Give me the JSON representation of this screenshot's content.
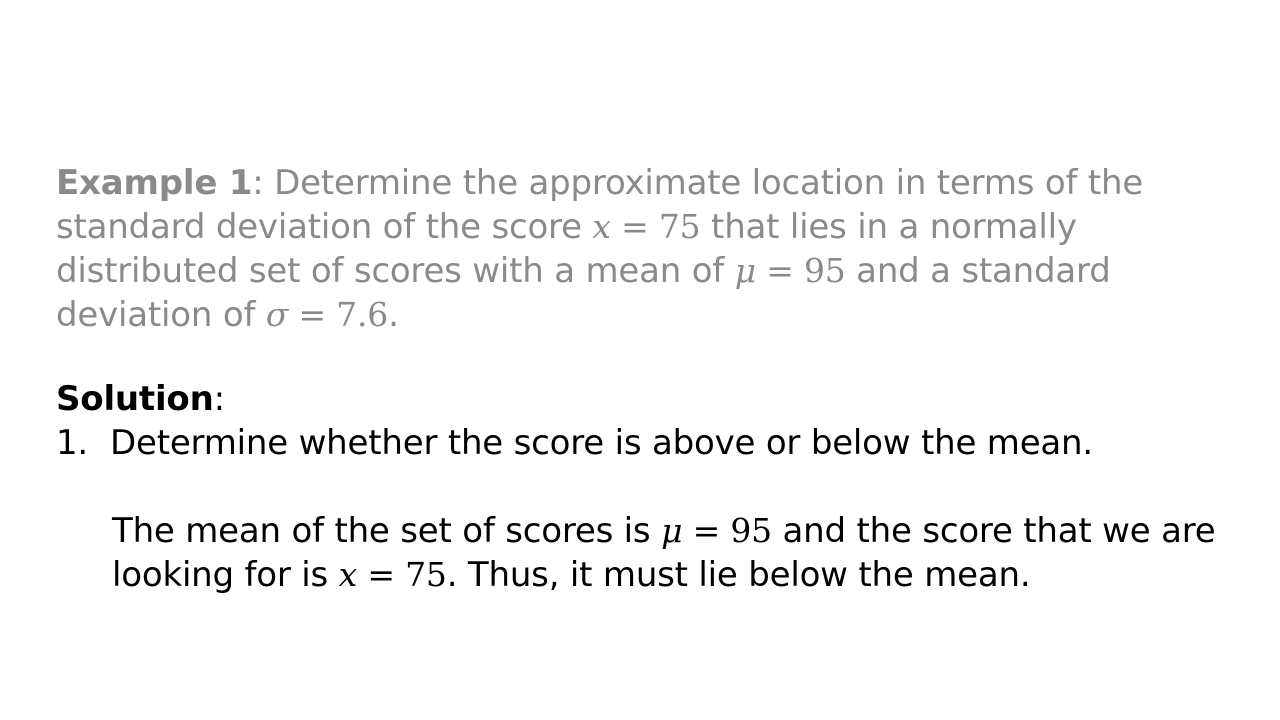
{
  "example": {
    "label": "Example 1",
    "text_1": ": Determine the approximate location in terms of the standard deviation of the score ",
    "score_eq": "x = 75",
    "text_2": " that lies in a normally distributed set of scores with a mean of ",
    "mean_eq": "μ = 95",
    "text_3": " and a standard deviation of ",
    "sd_eq": "σ = 7.6",
    "text_4": "."
  },
  "solution": {
    "heading": "Solution",
    "colon": ":",
    "steps": [
      {
        "number": "1.",
        "text": "Determine whether the score is above or below the mean.",
        "explanation": {
          "text_1": "The mean of the set of scores is ",
          "mean_eq": "μ = 95",
          "text_2": " and the score that we are looking for is ",
          "score_eq": "x = 75",
          "text_3": ". Thus, it must lie below the mean."
        }
      }
    ]
  }
}
